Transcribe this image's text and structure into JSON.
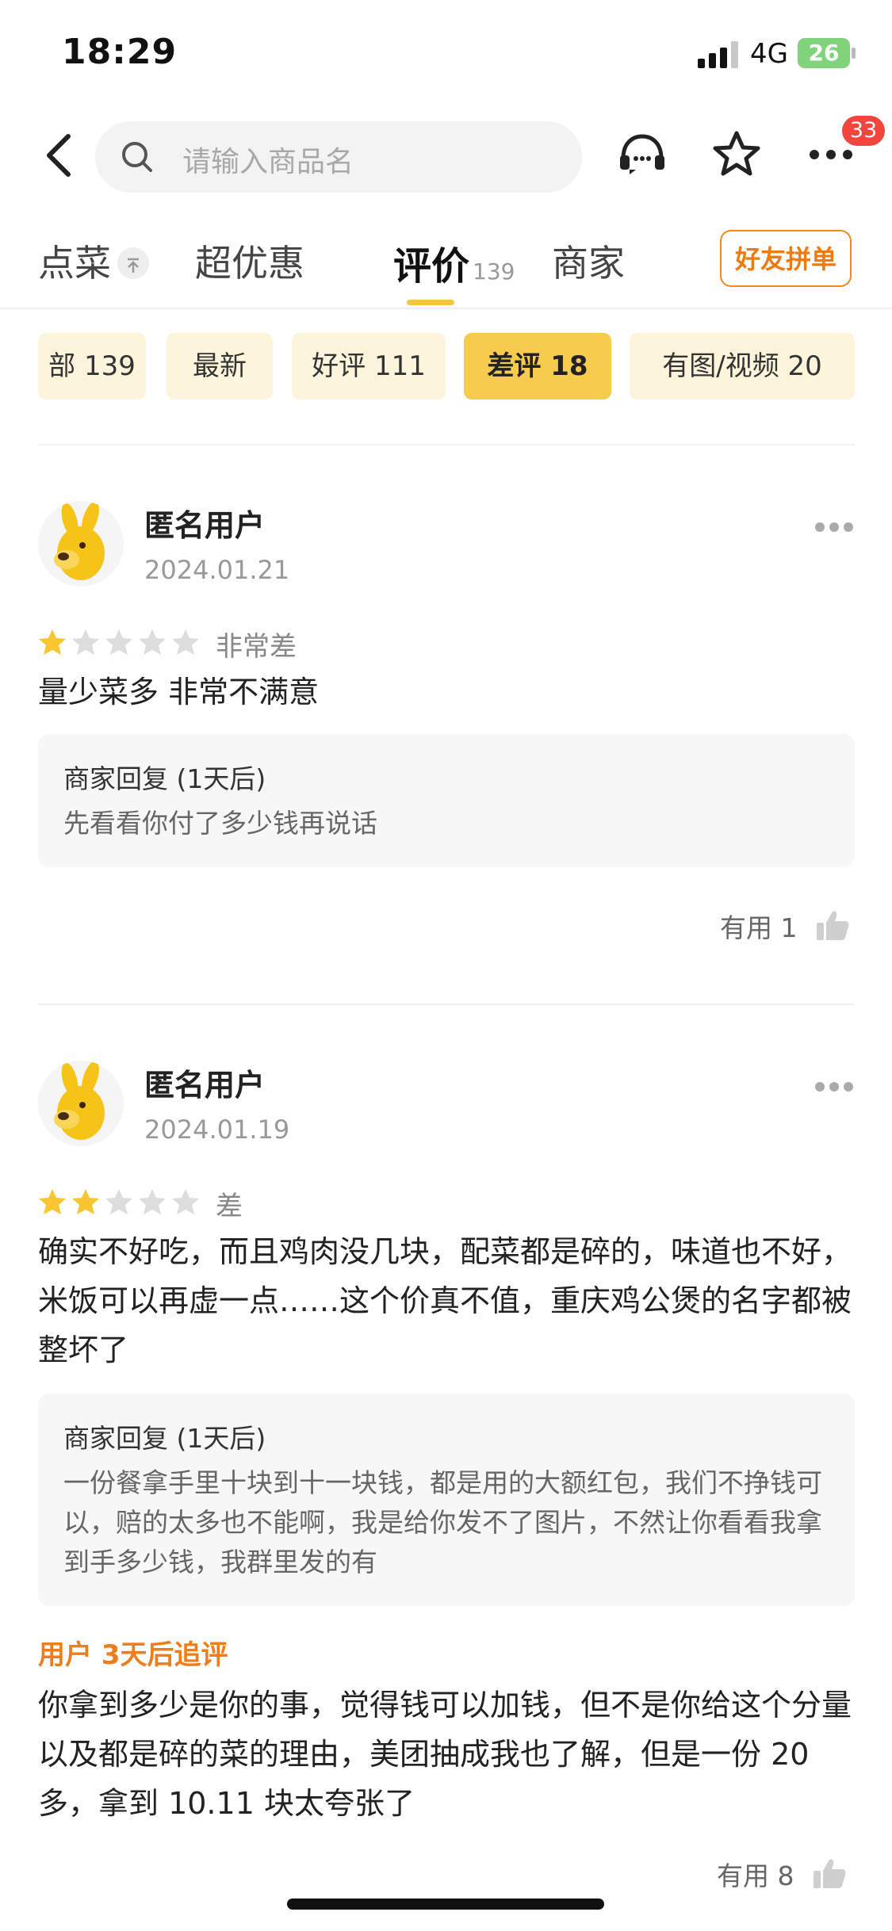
{
  "status_bar": {
    "time": "18:29",
    "network": "4G",
    "battery": "26"
  },
  "search": {
    "placeholder": "请输入商品名"
  },
  "header": {
    "badge_count": "33"
  },
  "tabs": [
    {
      "label": "点菜"
    },
    {
      "label": "超优惠"
    },
    {
      "label": "评价",
      "count": "139",
      "active": true
    },
    {
      "label": "商家"
    }
  ],
  "group_order_label": "好友拼单",
  "filters": [
    {
      "label": "部 139"
    },
    {
      "label": "最新"
    },
    {
      "label": "好评 111"
    },
    {
      "label": "差评 18",
      "active": true
    },
    {
      "label": "有图/视频 20"
    }
  ],
  "reviews": [
    {
      "user": "匿名用户",
      "date": "2024.01.21",
      "stars": 1,
      "rating_text": "非常差",
      "content": "量少菜多 非常不满意",
      "reply_title": "商家回复 (1天后)",
      "reply_text": "先看看你付了多少钱再说话",
      "helpful": "有用 1"
    },
    {
      "user": "匿名用户",
      "date": "2024.01.19",
      "stars": 2,
      "rating_text": "差",
      "content": "确实不好吃，而且鸡肉没几块，配菜都是碎的，味道也不好，米饭可以再虚一点……这个价真不值，重庆鸡公煲的名字都被整坏了",
      "reply_title": "商家回复 (1天后)",
      "reply_text": "一份餐拿手里十块到十一块钱，都是用的大额红包，我们不挣钱可以，赔的太多也不能啊，我是给你发不了图片，不然让你看看我拿到手多少钱，我群里发的有",
      "followup_label": "用户 3天后追评",
      "followup_text": "你拿到多少是你的事，觉得钱可以加钱，但不是你给这个分量以及都是碎的菜的理由，美团抽成我也了解，但是一份 20 多，拿到 10.11 块太夸张了",
      "helpful": "有用 8"
    }
  ],
  "colors": {
    "accent": "#f7cb4d",
    "orange": "#ef7d1a",
    "badge": "#f2453e",
    "star_on": "#f7c631",
    "star_off": "#dddddd"
  }
}
